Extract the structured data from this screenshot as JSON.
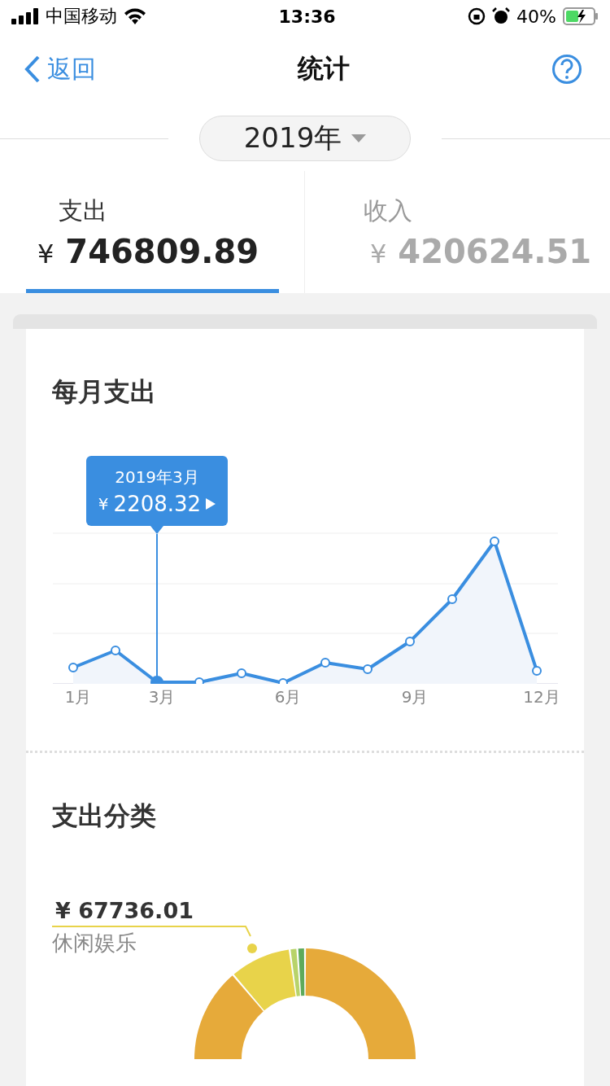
{
  "status_bar": {
    "carrier": "中国移动",
    "time": "13:36",
    "battery": "40%"
  },
  "nav": {
    "back": "返回",
    "title": "统计"
  },
  "year_selector": {
    "label": "2019年"
  },
  "tabs": [
    {
      "label": "支出",
      "currency": "¥",
      "amount": "746809.89",
      "selected": true
    },
    {
      "label": "收入",
      "currency": "¥",
      "amount": "420624.51",
      "selected": false
    }
  ],
  "monthly": {
    "title": "每月支出",
    "tooltip": {
      "month": "2019年3月",
      "currency": "¥",
      "amount": "2208.32"
    },
    "x_labels": [
      "1月",
      "3月",
      "6月",
      "9月",
      "12月"
    ]
  },
  "category": {
    "title": "支出分类",
    "callout": {
      "amount": "¥ 67736.01",
      "name": "休闲娱乐",
      "color": "#e8d34a"
    }
  }
}
